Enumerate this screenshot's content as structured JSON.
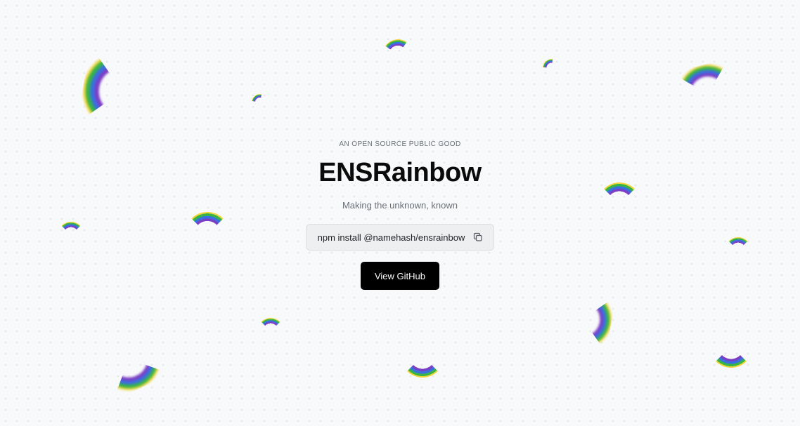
{
  "hero": {
    "eyebrow": "AN OPEN SOURCE PUBLIC GOOD",
    "title": "ENSRainbow",
    "subtitle": "Making the unknown, known",
    "install_command": "npm install @namehash/ensrainbow",
    "cta_label": "View GitHub"
  },
  "decor": {
    "icon": "rainbow-icon",
    "colors": [
      "#e63b2e",
      "#f58b2b",
      "#f1d63a",
      "#38b34a",
      "#3a6fe0",
      "#7b3fc5"
    ]
  }
}
